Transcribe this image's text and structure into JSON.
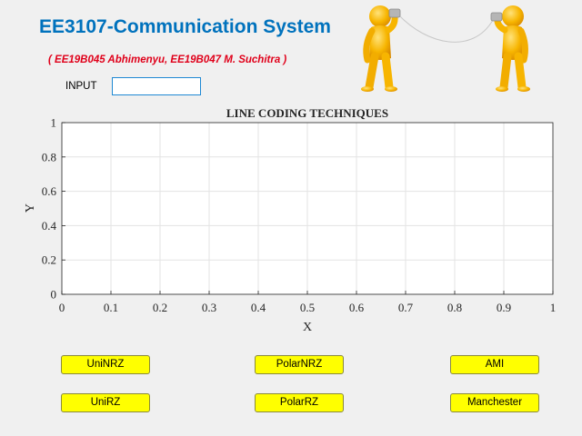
{
  "header": {
    "title": "EE3107-Communication System",
    "authors": "( EE19B045 Abhimenyu, EE19B047 M. Suchitra )"
  },
  "input": {
    "label": "INPUT",
    "value": ""
  },
  "chart_data": {
    "type": "line",
    "title": "LINE CODING TECHNIQUES",
    "xlabel": "X",
    "ylabel": "Y",
    "xlim": [
      0,
      1
    ],
    "ylim": [
      0,
      1
    ],
    "xticks": [
      "0",
      "0.1",
      "0.2",
      "0.3",
      "0.4",
      "0.5",
      "0.6",
      "0.7",
      "0.8",
      "0.9",
      "1"
    ],
    "yticks": [
      "0",
      "0.2",
      "0.4",
      "0.6",
      "0.8",
      "1"
    ],
    "grid": true,
    "series": []
  },
  "buttons": {
    "uninrz": "UniNRZ",
    "polarnrz": "PolarNRZ",
    "ami": "AMI",
    "unirz": "UniRZ",
    "polarrz": "PolarRZ",
    "manchester": "Manchester"
  },
  "colors": {
    "title": "#0072bd",
    "authors": "#e0001a",
    "button": "#ffff00",
    "figure": "#f5a800"
  }
}
